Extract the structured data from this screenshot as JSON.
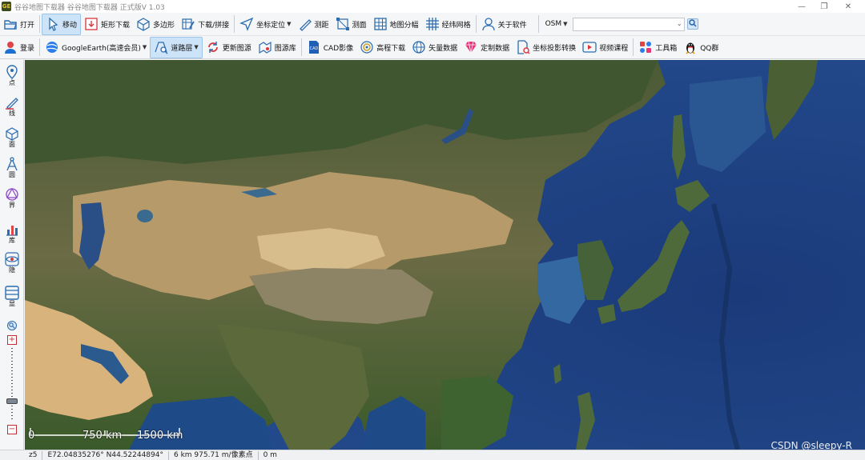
{
  "window": {
    "logo_text": "GE",
    "title": "谷谷地图下载器  谷谷地图下载器 正式版V 1.03",
    "minimize": "—",
    "maximize": "❐",
    "close": "✕"
  },
  "toolbar1": {
    "items": [
      {
        "label": "打开",
        "icon": "folder-open-icon"
      },
      {
        "label": "移动",
        "icon": "cursor-icon",
        "active": true
      },
      {
        "label": "矩形下载",
        "icon": "rect-download-icon"
      },
      {
        "label": "多边形",
        "icon": "polygon-cube-icon"
      },
      {
        "label": "下载/拼接",
        "icon": "edit-grid-icon"
      },
      {
        "label": "坐标定位",
        "icon": "locate-arrow-icon",
        "dropdown": true
      },
      {
        "label": "测距",
        "icon": "ruler-pencil-icon"
      },
      {
        "label": "测面",
        "icon": "area-measure-icon"
      },
      {
        "label": "地图分幅",
        "icon": "grid-icon"
      },
      {
        "label": "经纬网格",
        "icon": "hash-grid-icon"
      },
      {
        "label": "关于软件",
        "icon": "user-outline-icon"
      }
    ],
    "source_select": {
      "value": "OSM"
    },
    "search_input": {
      "value": "",
      "placeholder": ""
    }
  },
  "toolbar2": {
    "items": [
      {
        "label": "登录",
        "icon": "user-icon"
      },
      {
        "label": "GoogleEarth(高速会员)",
        "icon": "google-earth-icon",
        "dropdown": true
      },
      {
        "label": "道路层",
        "icon": "road-layer-icon",
        "dropdown": true,
        "active": true
      },
      {
        "label": "更新图源",
        "icon": "refresh-icon"
      },
      {
        "label": "图源库",
        "icon": "map-library-icon"
      },
      {
        "label": "CAD影像",
        "icon": "cad-file-icon"
      },
      {
        "label": "高程下载",
        "icon": "elevation-icon"
      },
      {
        "label": "矢量数据",
        "icon": "globe-vector-icon"
      },
      {
        "label": "定制数据",
        "icon": "diamond-icon"
      },
      {
        "label": "坐标投影转换",
        "icon": "projection-icon"
      },
      {
        "label": "视频课程",
        "icon": "video-icon"
      },
      {
        "label": "工具箱",
        "icon": "toolbox-icon"
      },
      {
        "label": "QQ群",
        "icon": "qq-penguin-icon"
      }
    ]
  },
  "sidebar": {
    "items": [
      {
        "label": "点",
        "icon": "point-marker-icon"
      },
      {
        "label": "线",
        "icon": "line-pen-icon"
      },
      {
        "label": "面",
        "icon": "polygon-face-icon"
      },
      {
        "label": "圆",
        "icon": "compass-icon"
      },
      {
        "label": "界",
        "icon": "boundary-icon"
      },
      {
        "label": "库",
        "icon": "library-chart-icon"
      },
      {
        "label": "隐",
        "icon": "eye-icon"
      },
      {
        "label": "显",
        "icon": "layers-icon"
      }
    ],
    "zoom_in": "+",
    "zoom_out": "−",
    "zoom_level_fraction": 0.27
  },
  "map": {
    "scale_labels": [
      "0",
      "750 km",
      "1500 km"
    ],
    "watermark": "CSDN @sleepy-R",
    "colors": {
      "ocean": "#1e3d78",
      "land_green": "#3f5a2e",
      "desert": "#c9ab7a"
    }
  },
  "status": {
    "zoom": "z5",
    "coords": "E72.04835276° N44.52244894°",
    "resolution": "6 km 975.71 m/像素点",
    "elevation": "0 m"
  }
}
